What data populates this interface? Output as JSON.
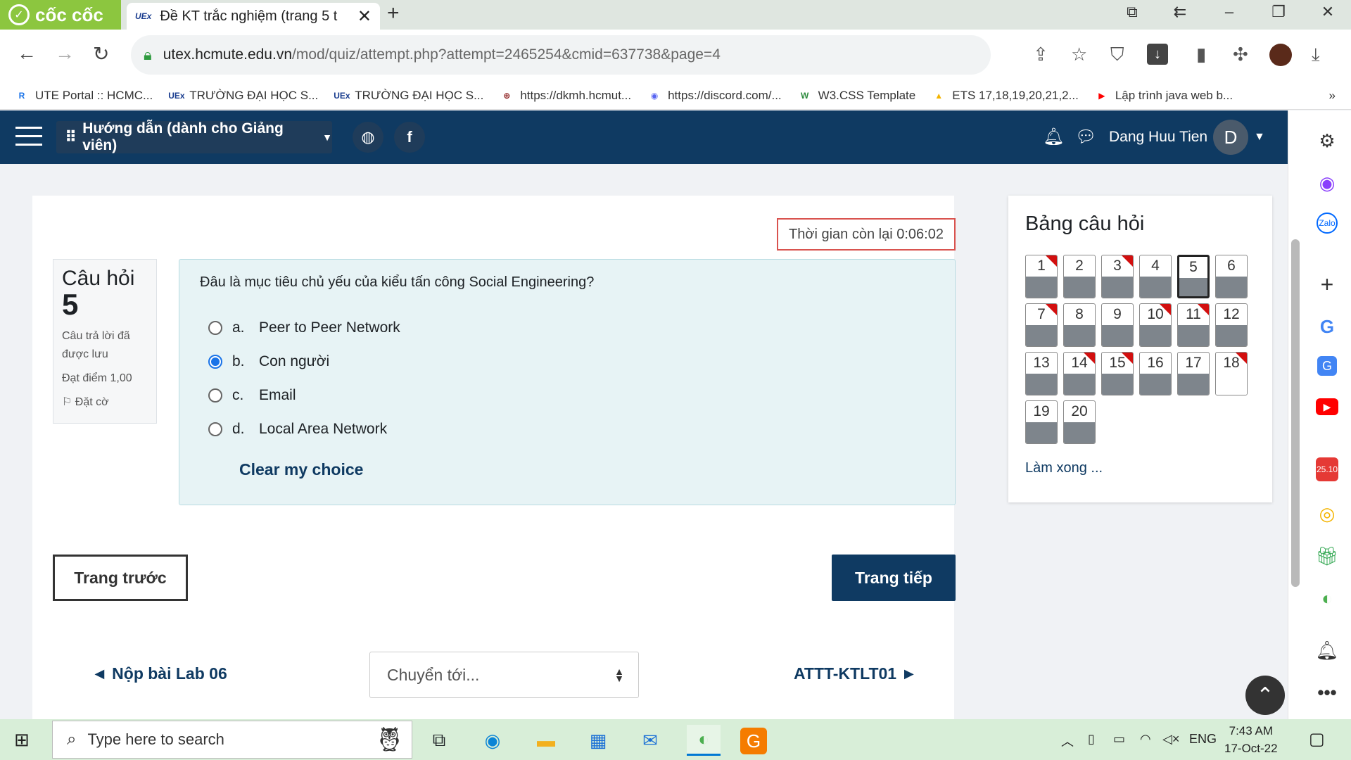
{
  "browser": {
    "logo_text": "cốc cốc",
    "tab_title": "Đề KT trắc nghiệm (trang 5 t",
    "tab_favicon": "UEx",
    "url_host": "utex.hcmute.edu.vn",
    "url_path": "/mod/quiz/attempt.php?attempt=2465254&cmid=637738&page=4",
    "bookmarks": [
      {
        "label": "UTE Portal :: HCMC...",
        "icon": "R",
        "color": "#1a73e8"
      },
      {
        "label": "TRƯỜNG ĐẠI HỌC S...",
        "icon": "UEx",
        "color": "#1a3d8f"
      },
      {
        "label": "TRƯỜNG ĐẠI HỌC S...",
        "icon": "UEx",
        "color": "#1a3d8f"
      },
      {
        "label": "https://dkmh.hcmut...",
        "icon": "⊕",
        "color": "#8b1a1a"
      },
      {
        "label": "https://discord.com/...",
        "icon": "◉",
        "color": "#5865f2"
      },
      {
        "label": "W3.CSS Template",
        "icon": "W",
        "color": "#2e8b3e"
      },
      {
        "label": "ETS 17,18,19,20,21,2...",
        "icon": "▲",
        "color": "#f4b400"
      },
      {
        "label": "Lập trình java web b...",
        "icon": "▶",
        "color": "#ff0000"
      }
    ],
    "more_bookmarks": "»"
  },
  "moodle": {
    "guide_label": "Hướng dẫn (dành cho Giảng viên)",
    "user_name": "Dang Huu Tien",
    "avatar_letter": "D"
  },
  "quiz": {
    "timer": "Thời gian còn lại 0:06:02",
    "question_label": "Câu hỏi",
    "question_number": "5",
    "status": "Câu trả lời đã được lưu",
    "grade": "Đạt điểm 1,00",
    "flag_label": "Đặt cờ",
    "question_text": "Đâu là mục tiêu chủ yếu của kiểu tấn công Social Engineering?",
    "options": [
      {
        "letter": "a.",
        "text": "Peer to Peer Network",
        "selected": false
      },
      {
        "letter": "b.",
        "text": "Con người",
        "selected": true
      },
      {
        "letter": "c.",
        "text": "Email",
        "selected": false
      },
      {
        "letter": "d.",
        "text": "Local Area Network",
        "selected": false
      }
    ],
    "clear_choice": "Clear my choice",
    "prev_page": "Trang trước",
    "next_page": "Trang tiếp",
    "prev_activity": "◄ Nộp bài Lab 06",
    "jump_placeholder": "Chuyển tới...",
    "next_activity": "ATTT-KTLT01 ►"
  },
  "quiz_nav": {
    "title": "Bảng câu hỏi",
    "finish_label": "Làm xong ...",
    "buttons": [
      {
        "n": "1",
        "answered": true,
        "flagged": true,
        "current": false
      },
      {
        "n": "2",
        "answered": true,
        "flagged": false,
        "current": false
      },
      {
        "n": "3",
        "answered": true,
        "flagged": true,
        "current": false
      },
      {
        "n": "4",
        "answered": true,
        "flagged": false,
        "current": false
      },
      {
        "n": "5",
        "answered": true,
        "flagged": false,
        "current": true
      },
      {
        "n": "6",
        "answered": true,
        "flagged": false,
        "current": false
      },
      {
        "n": "7",
        "answered": true,
        "flagged": true,
        "current": false
      },
      {
        "n": "8",
        "answered": true,
        "flagged": false,
        "current": false
      },
      {
        "n": "9",
        "answered": true,
        "flagged": false,
        "current": false
      },
      {
        "n": "10",
        "answered": true,
        "flagged": true,
        "current": false
      },
      {
        "n": "11",
        "answered": true,
        "flagged": true,
        "current": false
      },
      {
        "n": "12",
        "answered": true,
        "flagged": false,
        "current": false
      },
      {
        "n": "13",
        "answered": true,
        "flagged": false,
        "current": false
      },
      {
        "n": "14",
        "answered": true,
        "flagged": true,
        "current": false
      },
      {
        "n": "15",
        "answered": true,
        "flagged": true,
        "current": false
      },
      {
        "n": "16",
        "answered": true,
        "flagged": false,
        "current": false
      },
      {
        "n": "17",
        "answered": true,
        "flagged": false,
        "current": false
      },
      {
        "n": "18",
        "answered": false,
        "flagged": true,
        "current": false
      },
      {
        "n": "19",
        "answered": true,
        "flagged": false,
        "current": false
      },
      {
        "n": "20",
        "answered": true,
        "flagged": false,
        "current": false
      }
    ]
  },
  "taskbar": {
    "search_placeholder": "Type here to search",
    "lang": "ENG",
    "time": "7:43 AM",
    "date": "17-Oct-22"
  }
}
